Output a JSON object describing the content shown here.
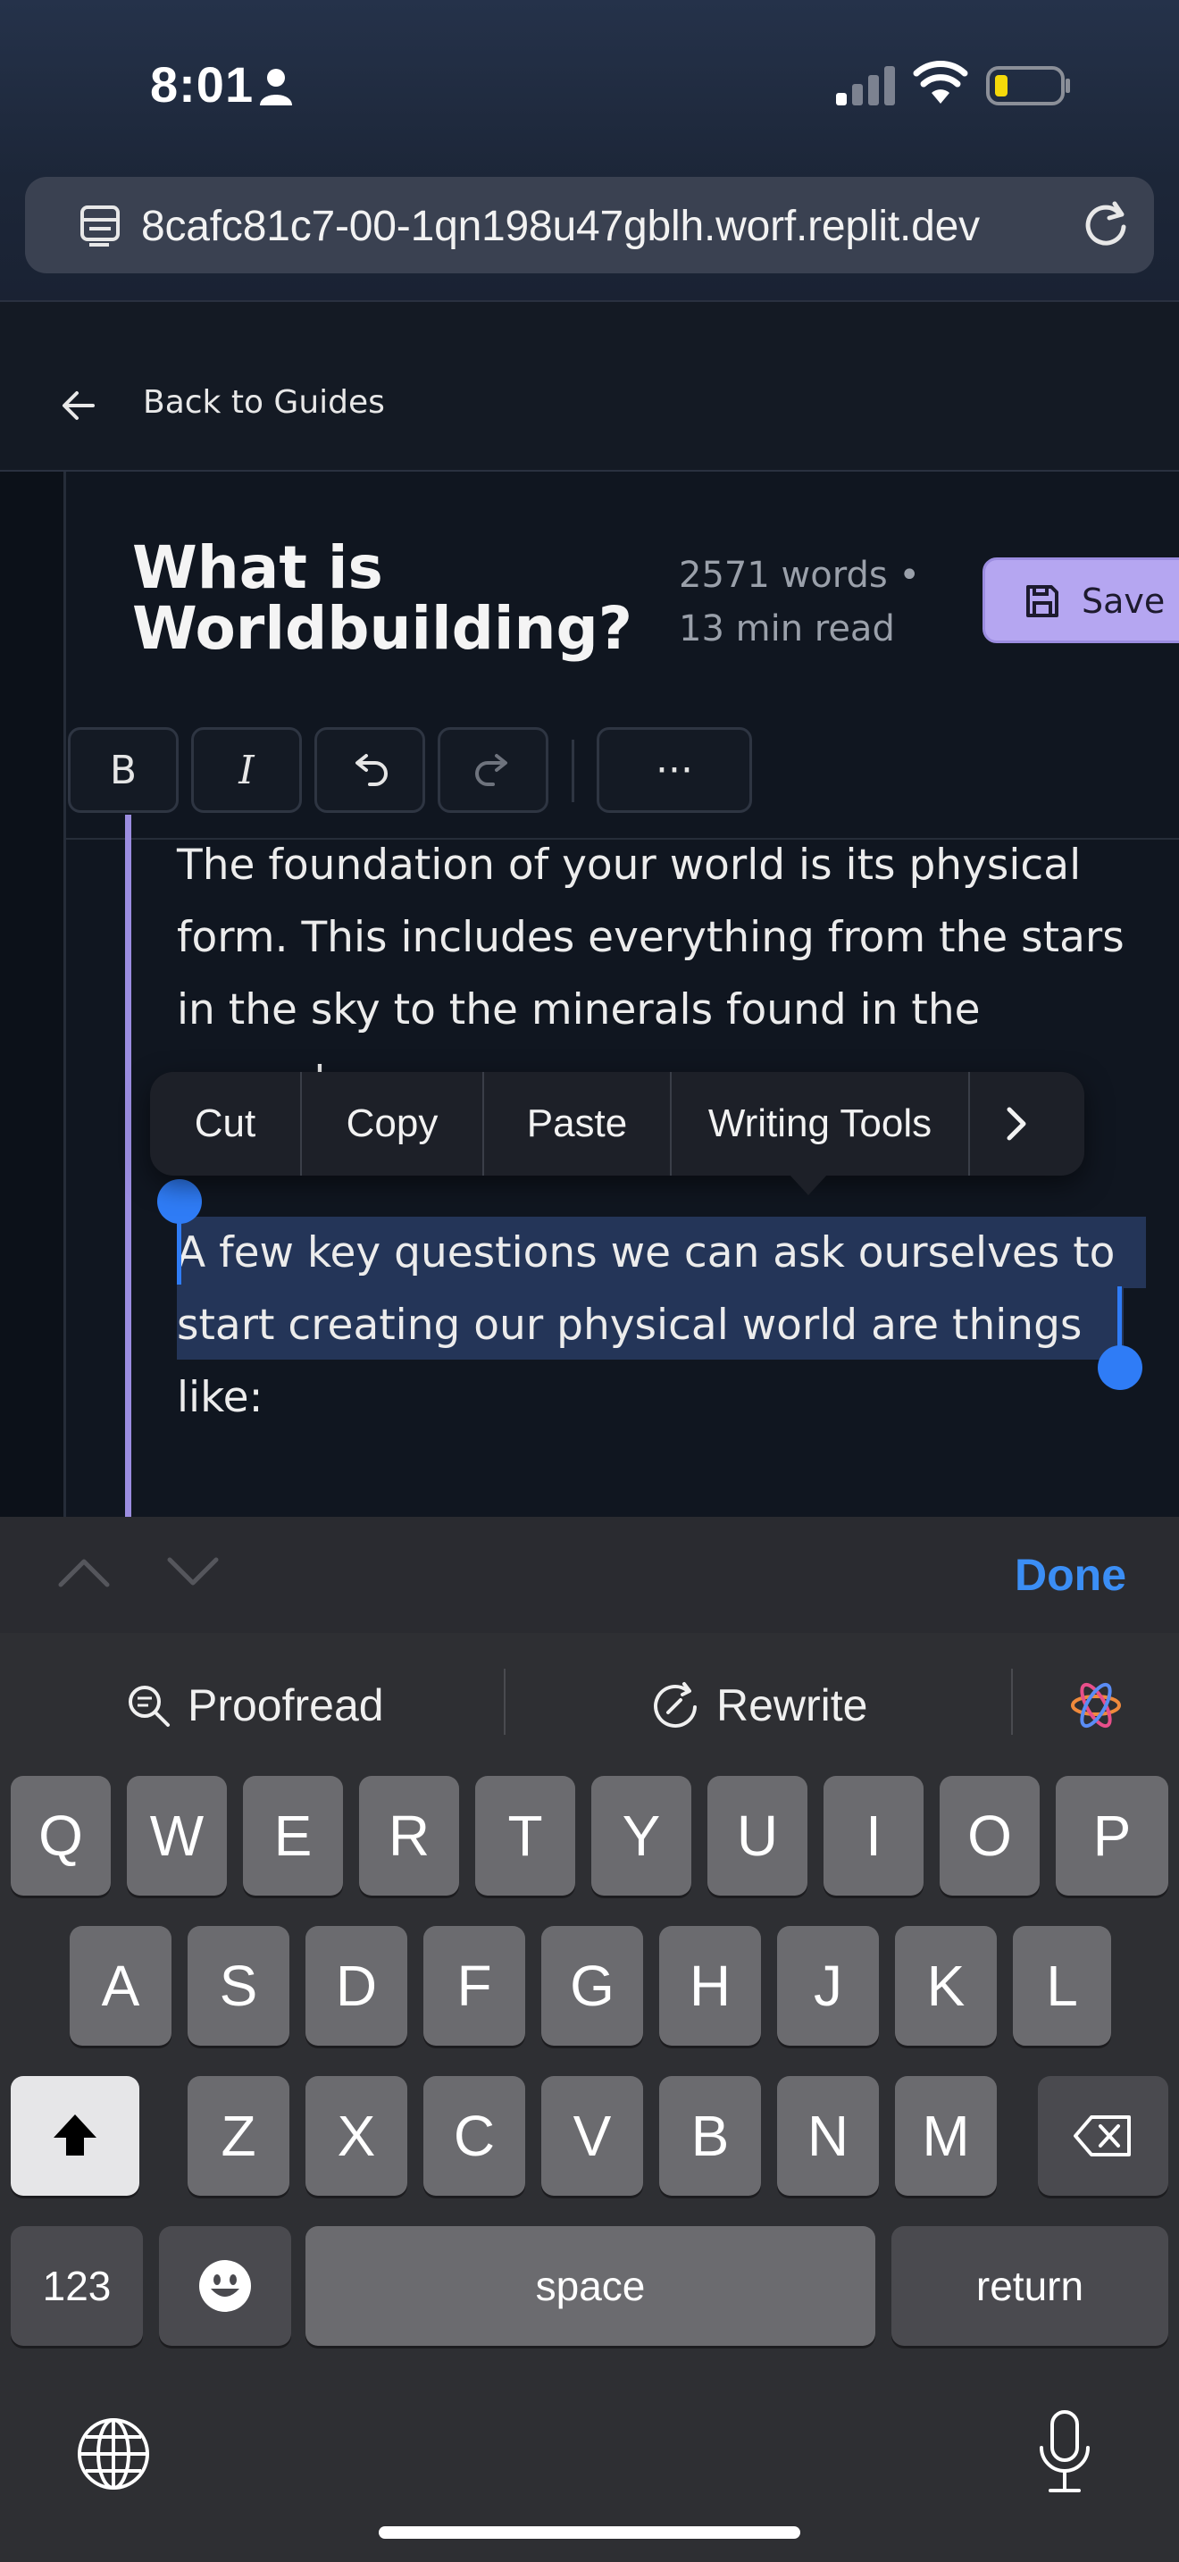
{
  "status_bar": {
    "time": "8:01"
  },
  "browser": {
    "url": "8cafc81c7-00-1qn198u47gblh.worf.replit.dev"
  },
  "header": {
    "back_label": "Back to Guides"
  },
  "document": {
    "title": "What is Worldbuilding?",
    "meta_words": "2571 words •",
    "meta_read": "13 min read",
    "save_label": "Save",
    "paragraphs": [
      "The foundation of your world is its physical form. This includes everything from the stars in the sky to the minerals found in the ground.",
      "A few key questions we can ask ourselves to start creating our physical world are things like:"
    ]
  },
  "toolbar": {
    "bold": "B",
    "italic": "I",
    "more": "···"
  },
  "context_menu": {
    "items": [
      "Cut",
      "Copy",
      "Paste",
      "Writing Tools"
    ]
  },
  "keyboard": {
    "done_label": "Done",
    "proofread_label": "Proofread",
    "rewrite_label": "Rewrite",
    "row1": [
      "Q",
      "W",
      "E",
      "R",
      "T",
      "Y",
      "U",
      "I",
      "O",
      "P"
    ],
    "row2": [
      "A",
      "S",
      "D",
      "F",
      "G",
      "H",
      "J",
      "K",
      "L"
    ],
    "row3": [
      "Z",
      "X",
      "C",
      "V",
      "B",
      "N",
      "M"
    ],
    "numbers_label": "123",
    "space_label": "space",
    "return_label": "return"
  },
  "colors": {
    "accent": "#b5a6f1",
    "selection": "#2f7cf6",
    "done": "#3b8ef5"
  }
}
